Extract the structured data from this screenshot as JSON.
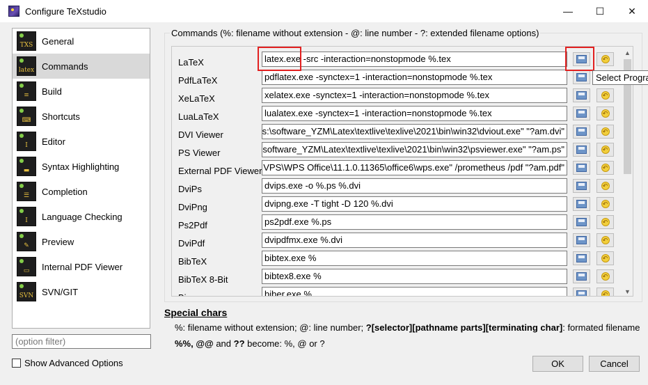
{
  "window": {
    "title": "Configure TeXstudio",
    "minimize": "—",
    "maximize": "☐",
    "close": "✕"
  },
  "sidebar": {
    "items": [
      {
        "label": "General",
        "icon": "TXS"
      },
      {
        "label": "Commands",
        "icon": "latex",
        "selected": true
      },
      {
        "label": "Build",
        "icon": "≡"
      },
      {
        "label": "Shortcuts",
        "icon": "⌨"
      },
      {
        "label": "Editor",
        "icon": "I"
      },
      {
        "label": "Syntax Highlighting",
        "icon": "▬"
      },
      {
        "label": "Completion",
        "icon": "☰"
      },
      {
        "label": "Language Checking",
        "icon": "I"
      },
      {
        "label": "Preview",
        "icon": "✎"
      },
      {
        "label": "Internal PDF Viewer",
        "icon": "▭"
      },
      {
        "label": "SVN/GIT",
        "icon": "SVN"
      }
    ],
    "filter_placeholder": "(option filter)",
    "advanced_label": "Show Advanced Options"
  },
  "commands": {
    "group_title": "Commands (%: filename without extension - @: line number - ?: extended filename options)",
    "rows": [
      {
        "label": "LaTeX",
        "value": "latex.exe -src -interaction=nonstopmode %.tex"
      },
      {
        "label": "PdfLaTeX",
        "value": "pdflatex.exe -synctex=1 -interaction=nonstopmode %.tex"
      },
      {
        "label": "XeLaTeX",
        "value": "xelatex.exe -synctex=1 -interaction=nonstopmode %.tex"
      },
      {
        "label": "LuaLaTeX",
        "value": "lualatex.exe -synctex=1 -interaction=nonstopmode %.tex"
      },
      {
        "label": "DVI Viewer",
        "value": "s:\\software_YZM\\Latex\\textlive\\texlive\\2021\\bin\\win32\\dviout.exe\" \"?am.dvi\"",
        "clipped": true
      },
      {
        "label": "PS Viewer",
        "value": "software_YZM\\Latex\\textlive\\texlive\\2021\\bin\\win32\\psviewer.exe\" \"?am.ps\"",
        "clipped": true
      },
      {
        "label": "External PDF Viewer",
        "value": "VPS\\WPS Office\\11.1.0.11365\\office6\\wps.exe\" /prometheus /pdf \"?am.pdf\"",
        "clipped": true
      },
      {
        "label": "DviPs",
        "value": "dvips.exe -o %.ps %.dvi"
      },
      {
        "label": "DviPng",
        "value": "dvipng.exe -T tight -D 120 %.dvi"
      },
      {
        "label": "Ps2Pdf",
        "value": "ps2pdf.exe %.ps"
      },
      {
        "label": "DviPdf",
        "value": "dvipdfmx.exe %.dvi"
      },
      {
        "label": "BibTeX",
        "value": "bibtex.exe %"
      },
      {
        "label": "BibTeX 8-Bit",
        "value": "bibtex8.exe %"
      },
      {
        "label": "Bi...",
        "value": "biber.exe %"
      }
    ],
    "tooltip": "Select Progra"
  },
  "special": {
    "title": "Special chars",
    "line1_a": "%: filename without extension; @: line number; ",
    "line1_b": "?[selector][pathname parts][terminating char]",
    "line1_c": ": formated filename",
    "line2_a": "%%, @@",
    "line2_b": " and ",
    "line2_c": "??",
    "line2_d": " become: %, @ or ?"
  },
  "buttons": {
    "ok": "OK",
    "cancel": "Cancel"
  },
  "colors": {
    "highlight": "#e22020",
    "selected_bg": "#d9d9d9"
  }
}
